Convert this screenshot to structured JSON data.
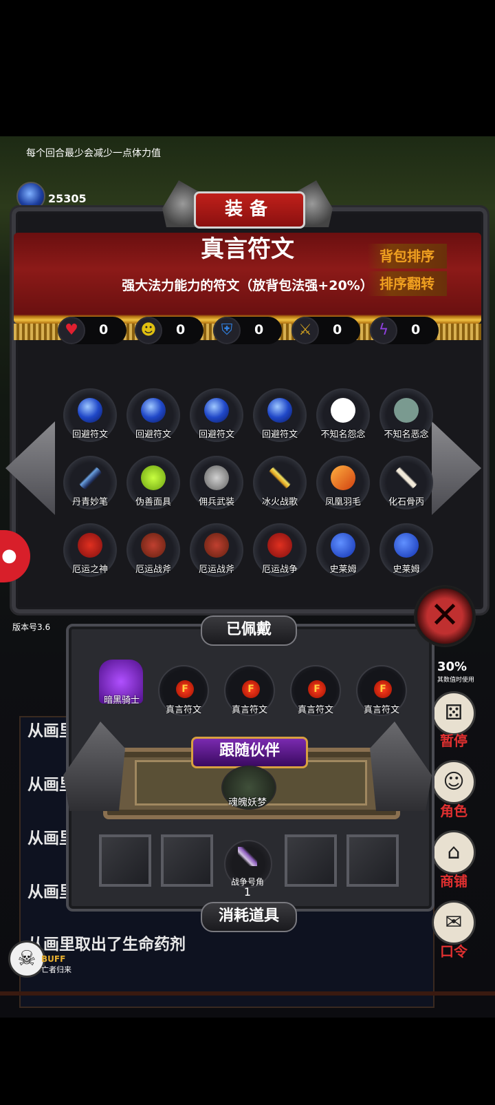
{
  "hud": {
    "hint": "每个回合最少会减少一点体力值",
    "gem_count": "25305"
  },
  "panel": {
    "title": "装备",
    "item_name": "真言符文",
    "item_desc": "强大法力能力的符文（放背包法强+20%）",
    "sort_bag_label": "背包排序",
    "sort_flip_label": "排序翻转"
  },
  "stats": [
    {
      "icon": "heart-icon",
      "value": "0",
      "color": "#e02030"
    },
    {
      "icon": "strength-icon",
      "value": "0",
      "color": "#e0c010"
    },
    {
      "icon": "armor-icon",
      "value": "0",
      "color": "#3080e0"
    },
    {
      "icon": "sword-icon",
      "value": "0",
      "color": "#d0a020"
    },
    {
      "icon": "lightning-icon",
      "value": "0",
      "color": "#9040e0"
    }
  ],
  "inventory": [
    {
      "label": "回避符文",
      "icon": "orb"
    },
    {
      "label": "回避符文",
      "icon": "orb"
    },
    {
      "label": "回避符文",
      "icon": "orb"
    },
    {
      "label": "回避符文",
      "icon": "orb"
    },
    {
      "label": "不知名怨念",
      "icon": "ghost"
    },
    {
      "label": "不知名恶念",
      "icon": "ghost2"
    },
    {
      "label": "丹青妙笔",
      "icon": "brush"
    },
    {
      "label": "伪善面具",
      "icon": "mask"
    },
    {
      "label": "佣兵武装",
      "icon": "helm"
    },
    {
      "label": "冰火战歌",
      "icon": "sword"
    },
    {
      "label": "凤凰羽毛",
      "icon": "feather"
    },
    {
      "label": "化石骨丙",
      "icon": "bone"
    },
    {
      "label": "厄运之神",
      "icon": "knight"
    },
    {
      "label": "厄运战斧",
      "icon": "axe"
    },
    {
      "label": "厄运战斧",
      "icon": "axe"
    },
    {
      "label": "厄运战争",
      "icon": "knight"
    },
    {
      "label": "史莱姆",
      "icon": "slime"
    },
    {
      "label": "史莱姆",
      "icon": "slime"
    }
  ],
  "side": {
    "version": "版本号3.6"
  },
  "equipped": {
    "title": "已佩戴",
    "items": [
      {
        "label": "暗黑骑士"
      },
      {
        "label": "真言符文",
        "rune": "F"
      },
      {
        "label": "真言符文",
        "rune": "F"
      },
      {
        "label": "真言符文",
        "rune": "F"
      },
      {
        "label": "真言符文",
        "rune": "F"
      }
    ]
  },
  "companion": {
    "title": "跟随伙伴",
    "name": "魂魄妖梦"
  },
  "consumables": {
    "title": "消耗道具",
    "item_label": "战争号角",
    "item_count": "1"
  },
  "log": [
    "从画里取出了",
    "从画里取出了",
    "从画里取出了",
    "从画里取出了",
    "从画里取出了生命药剂"
  ],
  "menu": {
    "percent": "30%",
    "percent_sub": "其数值时使用",
    "pause": "暂停",
    "role": "角色",
    "shop": "商铺",
    "password": "口令"
  },
  "buff": {
    "title": "BUFF",
    "sub": "亡者归来"
  }
}
